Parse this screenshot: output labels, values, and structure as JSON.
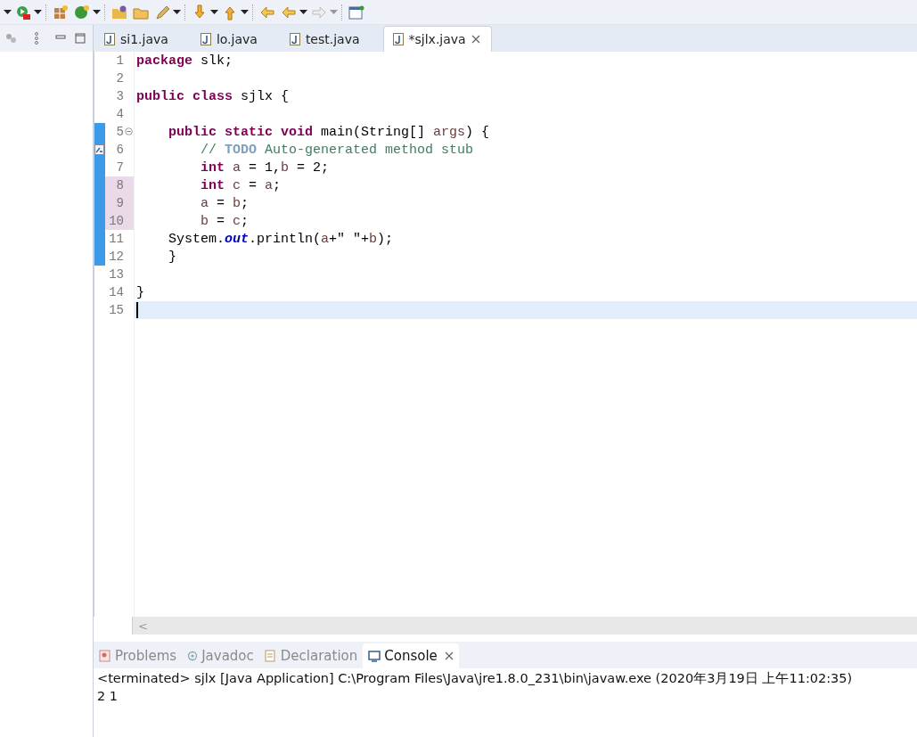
{
  "editor_tabs": [
    {
      "label": "si1.java",
      "selected": false
    },
    {
      "label": "lo.java",
      "selected": false
    },
    {
      "label": "test.java",
      "selected": false
    },
    {
      "label": "*sjlx.java",
      "selected": true
    }
  ],
  "code_lines": [
    {
      "number": "1",
      "changed": false,
      "modified": false,
      "current": false,
      "fold": false,
      "task": false,
      "tokens": [
        {
          "kind": "keyword",
          "text": "package"
        },
        {
          "kind": "plain",
          "text": " slk;"
        }
      ]
    },
    {
      "number": "2",
      "changed": false,
      "modified": false,
      "current": false,
      "fold": false,
      "task": false
    },
    {
      "number": "3",
      "changed": false,
      "modified": false,
      "current": false,
      "fold": false,
      "task": false,
      "tokens": [
        {
          "kind": "keyword",
          "text": "public class"
        },
        {
          "kind": "plain",
          "text": " sjlx {"
        }
      ]
    },
    {
      "number": "4",
      "changed": false,
      "modified": false,
      "current": false,
      "fold": false,
      "task": false
    },
    {
      "number": "5",
      "changed": true,
      "modified": false,
      "current": false,
      "fold": true,
      "task": false,
      "tokens": [
        {
          "kind": "keyword",
          "text": "    public static void"
        },
        {
          "kind": "plain",
          "text": " main(String[] "
        },
        {
          "kind": "param",
          "text": "args"
        },
        {
          "kind": "plain",
          "text": ") {"
        }
      ]
    },
    {
      "number": "6",
      "changed": true,
      "modified": false,
      "current": false,
      "fold": false,
      "task": true,
      "tokens": [
        {
          "kind": "comment",
          "text": "        // "
        },
        {
          "kind": "todo",
          "text": "TODO"
        },
        {
          "kind": "comment",
          "text": " Auto-generated method stub"
        }
      ]
    },
    {
      "number": "7",
      "changed": true,
      "modified": false,
      "current": false,
      "fold": false,
      "task": false,
      "tokens": [
        {
          "kind": "keyword",
          "text": "        int"
        },
        {
          "kind": "local",
          "text": " a"
        },
        {
          "kind": "plain",
          "text": " = 1,"
        },
        {
          "kind": "local",
          "text": "b"
        },
        {
          "kind": "plain",
          "text": " = 2;"
        }
      ]
    },
    {
      "number": "8",
      "changed": true,
      "modified": true,
      "current": false,
      "fold": false,
      "task": false,
      "tokens": [
        {
          "kind": "keyword",
          "text": "        int"
        },
        {
          "kind": "local",
          "text": " c"
        },
        {
          "kind": "plain",
          "text": " = "
        },
        {
          "kind": "local",
          "text": "a"
        },
        {
          "kind": "plain",
          "text": ";"
        }
      ]
    },
    {
      "number": "9",
      "changed": true,
      "modified": true,
      "current": false,
      "fold": false,
      "task": false,
      "tokens": [
        {
          "kind": "local",
          "text": "        a"
        },
        {
          "kind": "plain",
          "text": " = "
        },
        {
          "kind": "local",
          "text": "b"
        },
        {
          "kind": "plain",
          "text": ";"
        }
      ]
    },
    {
      "number": "10",
      "changed": true,
      "modified": true,
      "current": false,
      "fold": false,
      "task": false,
      "tokens": [
        {
          "kind": "local",
          "text": "        b"
        },
        {
          "kind": "plain",
          "text": " = "
        },
        {
          "kind": "local",
          "text": "c"
        },
        {
          "kind": "plain",
          "text": ";"
        }
      ]
    },
    {
      "number": "11",
      "changed": true,
      "modified": false,
      "current": false,
      "fold": false,
      "task": false,
      "tokens": [
        {
          "kind": "plain",
          "text": "    System."
        },
        {
          "kind": "field",
          "text": "out"
        },
        {
          "kind": "plain",
          "text": ".println("
        },
        {
          "kind": "local",
          "text": "a"
        },
        {
          "kind": "plain",
          "text": "+\" \"+"
        },
        {
          "kind": "local",
          "text": "b"
        },
        {
          "kind": "plain",
          "text": ");"
        }
      ]
    },
    {
      "number": "12",
      "changed": true,
      "modified": false,
      "current": false,
      "fold": false,
      "task": false,
      "tokens": [
        {
          "kind": "plain",
          "text": "    }"
        }
      ]
    },
    {
      "number": "13",
      "changed": false,
      "modified": false,
      "current": false,
      "fold": false,
      "task": false
    },
    {
      "number": "14",
      "changed": false,
      "modified": false,
      "current": false,
      "fold": false,
      "task": false,
      "tokens": [
        {
          "kind": "plain",
          "text": "}"
        }
      ]
    },
    {
      "number": "15",
      "changed": false,
      "modified": false,
      "current": true,
      "fold": false,
      "task": false
    }
  ],
  "scroll_arrow": "<",
  "bottom_tabs": [
    {
      "label": "Problems",
      "kind": "problems",
      "selected": false
    },
    {
      "label": "Javadoc",
      "kind": "javadoc",
      "selected": false
    },
    {
      "label": "Declaration",
      "kind": "declaration",
      "selected": false
    },
    {
      "label": "Console",
      "kind": "console",
      "selected": true
    }
  ],
  "console": {
    "header": "<terminated> sjlx [Java Application] C:\\Program Files\\Java\\jre1.8.0_231\\bin\\javaw.exe (2020年3月19日 上午11:02:35)",
    "output": "2 1"
  }
}
